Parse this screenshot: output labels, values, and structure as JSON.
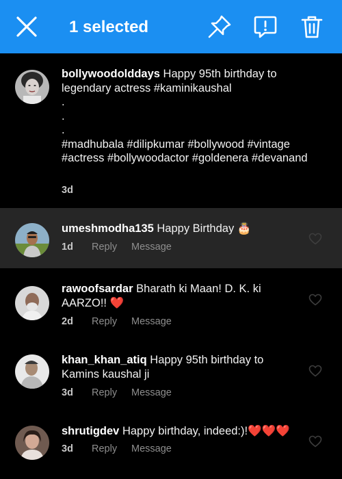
{
  "header": {
    "title": "1 selected",
    "background_color": "#1b8ff2",
    "icons": [
      "close-icon",
      "pin-icon",
      "report-icon",
      "delete-icon"
    ]
  },
  "post": {
    "username": "bollywoodolddays",
    "text_line1": " Happy 95th birthday to legendary actress #kaminikaushal",
    "dot1": ".",
    "dot2": ".",
    "dot3": ".",
    "hashtags": " #madhubala #dilipkumar #bollywood #vintage #actress #bollywoodactor #goldenera #devanand",
    "age": "3d"
  },
  "comments": [
    {
      "username": "umeshmodha135",
      "text": " Happy Birthday 🎂",
      "age": "1d",
      "reply": "Reply",
      "message": "Message",
      "selected": true
    },
    {
      "username": "rawoofsardar",
      "text": " Bharath ki Maan! D. K. ki AARZO!! ❤️",
      "age": "2d",
      "reply": "Reply",
      "message": "Message"
    },
    {
      "username": "khan_khan_atiq",
      "text": " Happy 95th birthday to Kamins kaushal ji",
      "age": "3d",
      "reply": "Reply",
      "message": "Message"
    },
    {
      "username": "shrutigdev",
      "text": " Happy birthday, indeed:)!❤️❤️❤️",
      "age": "3d",
      "reply": "Reply",
      "message": "Message"
    }
  ]
}
